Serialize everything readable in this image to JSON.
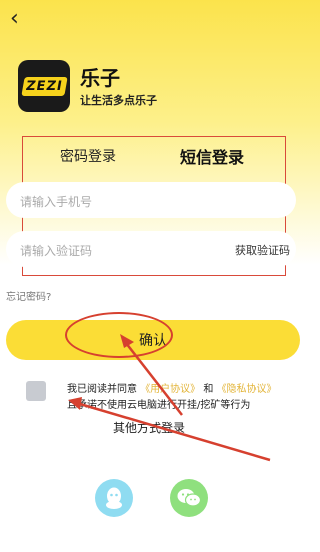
{
  "header": {
    "back_icon": "chevron-left-icon",
    "back_glyph": "‹"
  },
  "brand": {
    "logo_text": "ZEZI",
    "app_name": "乐子",
    "slogan": "让生活多点乐子"
  },
  "login_tabs": {
    "password_tab": "密码登录",
    "sms_tab": "短信登录",
    "active": "sms_tab"
  },
  "form": {
    "phone_placeholder": "请输入手机号",
    "code_placeholder": "请输入验证码",
    "get_code_label": "获取验证码",
    "forgot_label": "忘记密码?"
  },
  "confirm_button": {
    "label": "确认"
  },
  "agreement": {
    "checked": false,
    "text_prefix": "我已阅读并同意",
    "user_agreement": "《用户协议》",
    "connector": "和",
    "privacy_policy": "《隐私协议》",
    "line2": "且承诺不使用云电脑进行开挂/挖矿等行为"
  },
  "other_login": {
    "label": "其他方式登录",
    "qq_icon": "qq-icon",
    "wechat_icon": "wechat-icon"
  },
  "colors": {
    "brand_yellow": "#fbdd36",
    "annotation_red": "#d6402f",
    "link_gold": "#e3b53a",
    "qq_blue": "#8fdcf1",
    "wechat_green": "#8fe07e"
  }
}
